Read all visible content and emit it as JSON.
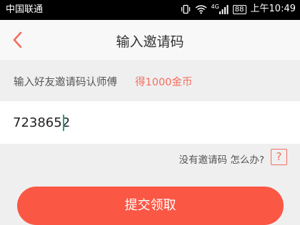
{
  "status_bar": {
    "carrier": "中国联通",
    "network_label": "4G",
    "battery": "88",
    "time": "上午10:49",
    "icons": [
      "vibrate-icon",
      "wifi-icon",
      "signal-icon",
      "battery-icon"
    ]
  },
  "nav": {
    "title": "输入邀请码",
    "back_icon": "chevron-left-icon"
  },
  "hint": {
    "text": "输入好友邀请码认师傅",
    "reward": "得1000金币"
  },
  "invite_input": {
    "value": "7238652",
    "placeholder": ""
  },
  "help": {
    "text": "没有邀请码 怎么办?",
    "icon_text": "?"
  },
  "submit": {
    "label": "提交领取"
  },
  "colors": {
    "accent": "#fa5745",
    "reward_text": "#f26d5b",
    "caret": "#1aa58f"
  }
}
